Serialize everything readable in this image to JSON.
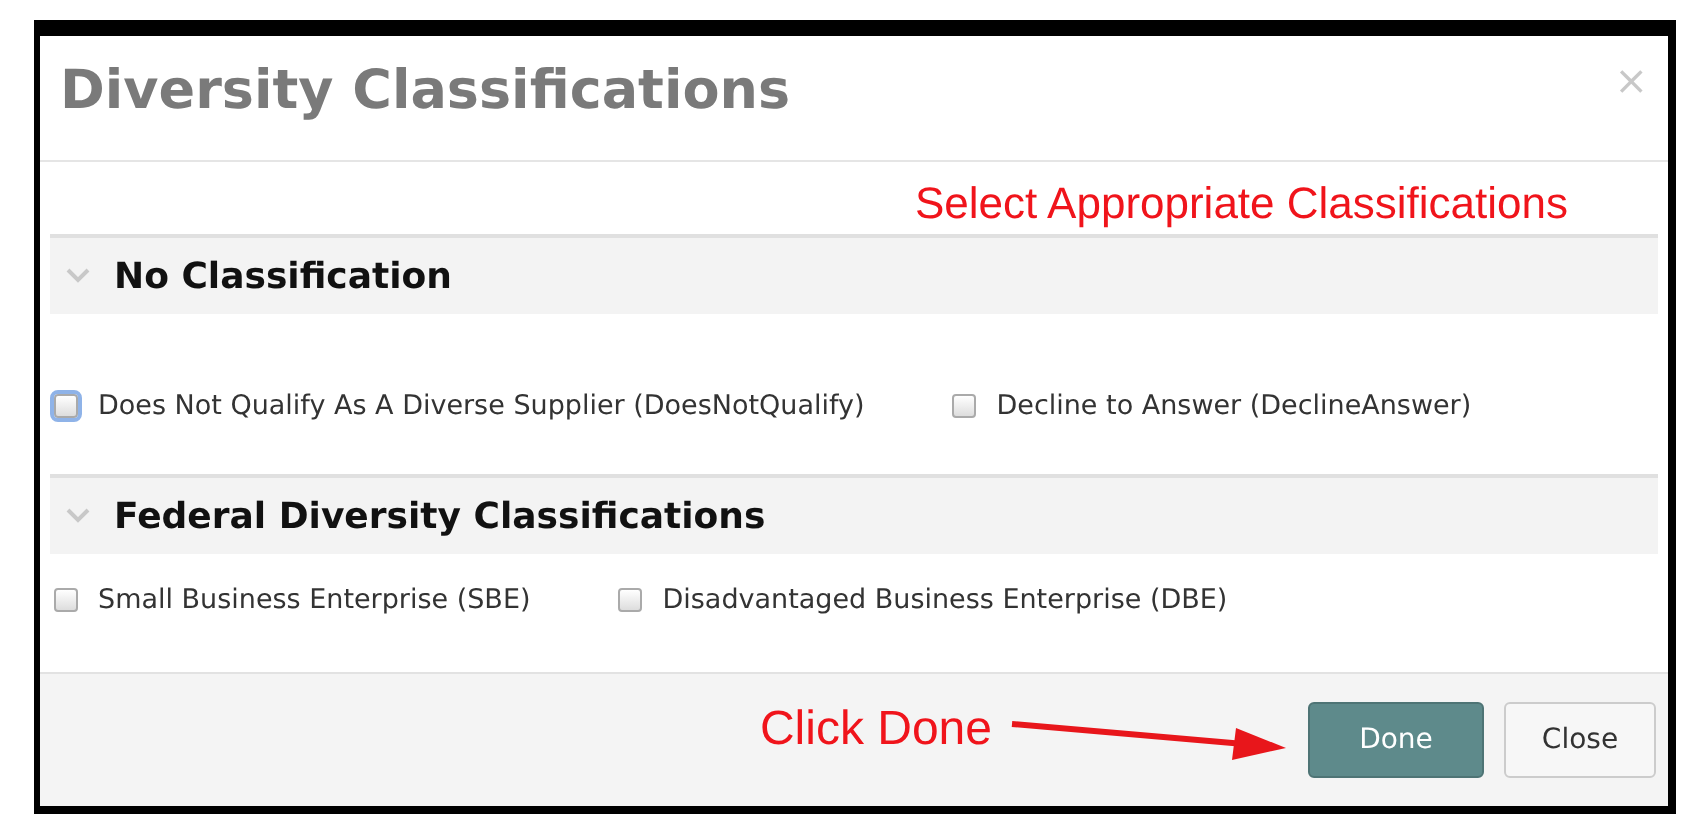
{
  "dialog": {
    "title": "Diversity Classifications",
    "close_icon": "×"
  },
  "annotations": {
    "instruction": "Select Appropriate Classifications",
    "pointer": "Click Done"
  },
  "sections": [
    {
      "title": "No Classification",
      "expanded": true,
      "options": [
        {
          "label": "Does Not Qualify As A Diverse Supplier (DoesNotQualify)",
          "checked": false,
          "focused": true
        },
        {
          "label": "Decline to Answer (DeclineAnswer)",
          "checked": false,
          "focused": false
        }
      ]
    },
    {
      "title": "Federal Diversity Classifications",
      "expanded": true,
      "options": [
        {
          "label": "Small Business Enterprise (SBE)",
          "checked": false,
          "focused": false
        },
        {
          "label": "Disadvantaged Business Enterprise (DBE)",
          "checked": false,
          "focused": false
        }
      ]
    }
  ],
  "buttons": [
    {
      "label": "Done",
      "kind": "primary"
    },
    {
      "label": "Close",
      "kind": "secondary"
    }
  ]
}
